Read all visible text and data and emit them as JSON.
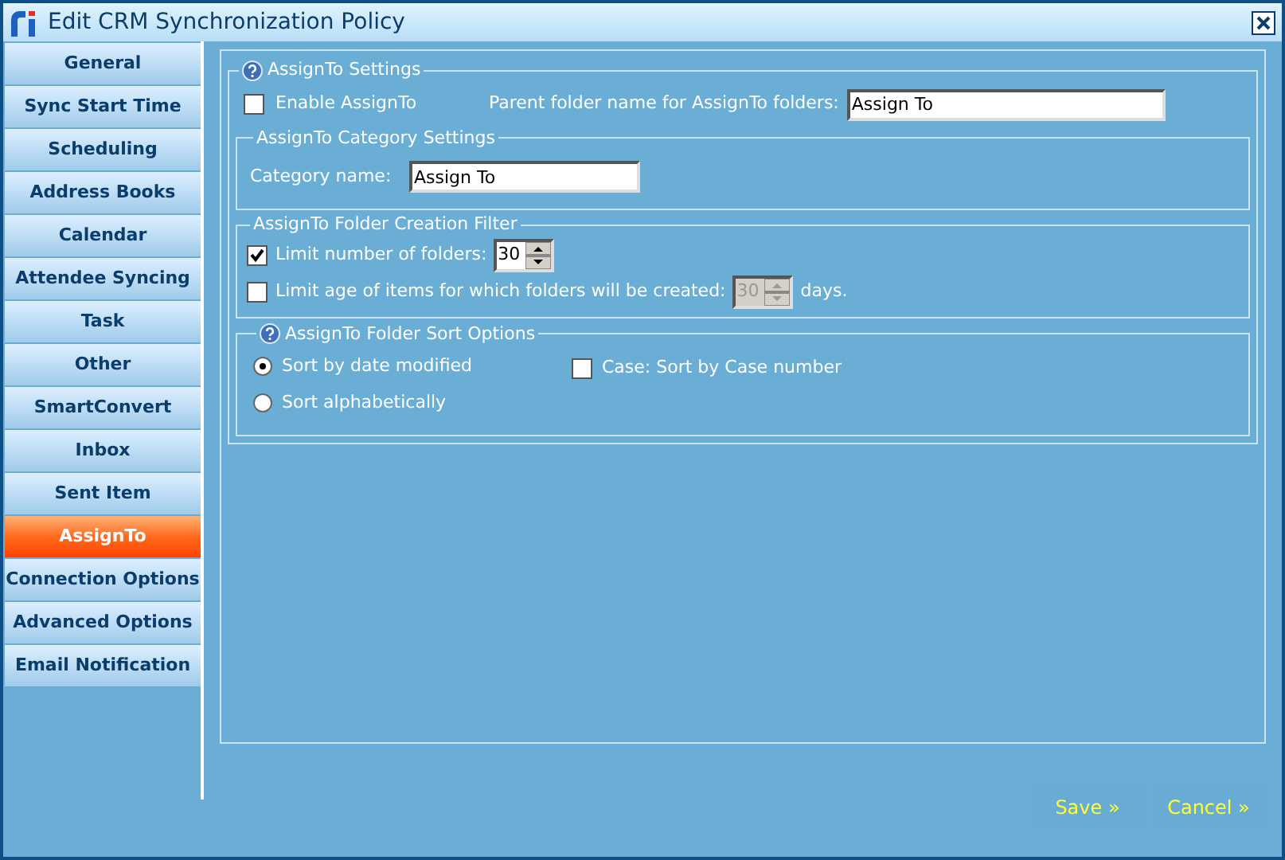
{
  "window": {
    "title": "Edit CRM Synchronization Policy"
  },
  "sidebar": {
    "items": [
      {
        "label": "General",
        "selected": false
      },
      {
        "label": "Sync Start Time",
        "selected": false
      },
      {
        "label": "Scheduling",
        "selected": false
      },
      {
        "label": "Address Books",
        "selected": false
      },
      {
        "label": "Calendar",
        "selected": false
      },
      {
        "label": "Attendee Syncing",
        "selected": false
      },
      {
        "label": "Task",
        "selected": false
      },
      {
        "label": "Other",
        "selected": false
      },
      {
        "label": "SmartConvert",
        "selected": false
      },
      {
        "label": "Inbox",
        "selected": false
      },
      {
        "label": "Sent Item",
        "selected": false
      },
      {
        "label": "AssignTo",
        "selected": true
      },
      {
        "label": "Connection Options",
        "selected": false
      },
      {
        "label": "Advanced Options",
        "selected": false
      },
      {
        "label": "Email Notification",
        "selected": false
      }
    ]
  },
  "assignto_settings": {
    "title": "AssignTo Settings",
    "enable": {
      "label": "Enable AssignTo",
      "checked": false
    },
    "parent_folder": {
      "label": "Parent folder name for AssignTo folders:",
      "value": "Assign To"
    },
    "category_settings": {
      "title": "AssignTo Category Settings",
      "label": "Category name:",
      "value": "Assign To"
    },
    "filter": {
      "title": "AssignTo Folder Creation Filter",
      "rows": [
        {
          "label": "Limit number of folders:",
          "checked": true,
          "value": "30",
          "disabled": false
        },
        {
          "label": "Limit age of items for which folders will be created:",
          "checked": false,
          "value": "30",
          "disabled": true,
          "suffix": "days."
        }
      ]
    },
    "sort_options": {
      "title": "AssignTo Folder Sort Options",
      "options": [
        {
          "label": "Sort by date modified",
          "selected": true
        },
        {
          "label": "Sort alphabetically",
          "selected": false
        }
      ],
      "case": {
        "label": "Case: Sort by Case number",
        "checked": false
      }
    }
  },
  "buttons": [
    {
      "label": "Save »"
    },
    {
      "label": "Cancel »"
    }
  ]
}
